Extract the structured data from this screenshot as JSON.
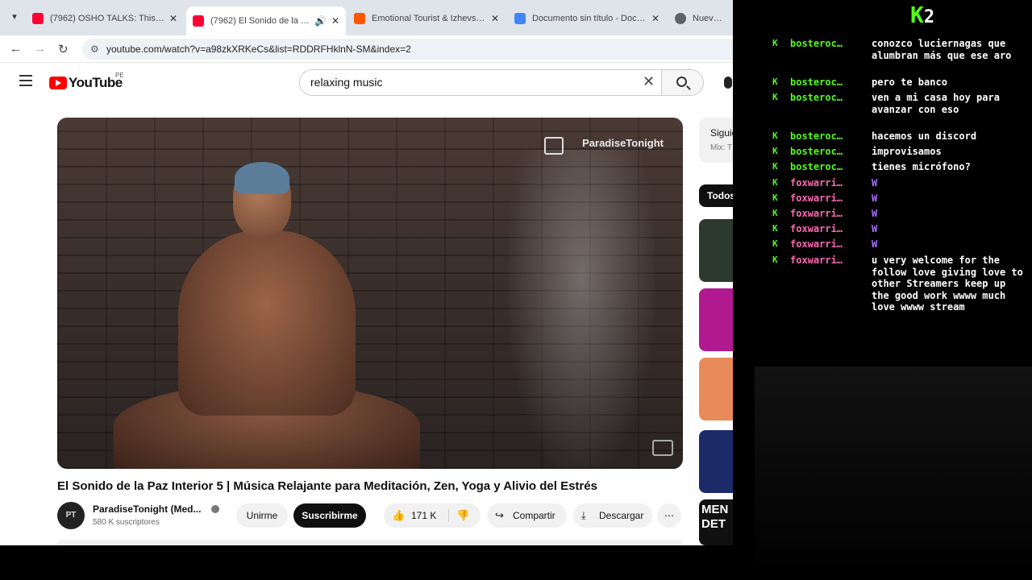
{
  "tabs": [
    {
      "title": "(7962) OSHO TALKS: This Is Onl",
      "favicon_color": "#ff0033",
      "active": false
    },
    {
      "title": "(7962) El Sonido de la Paz In",
      "favicon_color": "#ff0033",
      "active": true
    },
    {
      "title": "Emotional Tourist & Izhevski - L",
      "favicon_color": "#ff5500",
      "active": false
    },
    {
      "title": "Documento sin título - Docume",
      "favicon_color": "#4285f4",
      "active": false
    },
    {
      "title": "Nueva pest",
      "favicon_color": "#5f6368",
      "active": false
    }
  ],
  "address": {
    "url": "youtube.com/watch?v=a98zkXRKeCs&list=RDDRFHklnN-SM&index=2"
  },
  "youtube": {
    "logo_text": "YouTube",
    "country": "PE",
    "search_value": "relaxing music",
    "video": {
      "watermark": "ParadiseTonight",
      "title": "El Sonido de la Paz Interior 5 | Música Relajante para Meditación, Zen, Yoga y Alivio del Estrés",
      "channel": "ParadiseTonight (Med...",
      "avatar_text": "PT",
      "subscribers": "580 K suscriptores",
      "join_label": "Unirme",
      "subscribe_label": "Suscribirme",
      "likes": "171 K",
      "share_label": "Compartir",
      "download_label": "Descargar"
    },
    "sidebar": {
      "next_label": "Siguie",
      "next_sub": "Mix: T",
      "chip_all": "Todos",
      "thumb_colors": [
        "#2b3a2c",
        "#b0198f",
        "#e88a5a",
        "#1d2a6a",
        "#101010"
      ],
      "last_thumb_text": "MEN DET"
    }
  },
  "stream": {
    "logo": "K",
    "logo_num": "2",
    "chat": [
      {
        "user": "bosteroc…",
        "color": "green",
        "msg": "conozco luciernagas que alumbran más que ese aro"
      },
      {
        "user": "bosteroc…",
        "color": "green",
        "msg": "pero te banco"
      },
      {
        "user": "bosteroc…",
        "color": "green",
        "msg": "ven a mi casa hoy para avanzar con eso"
      },
      {
        "user": "bosteroc…",
        "color": "green",
        "msg": "hacemos un discord"
      },
      {
        "user": "bosteroc…",
        "color": "green",
        "msg": "improvisamos"
      },
      {
        "user": "bosteroc…",
        "color": "green",
        "msg": "tienes micrófono?"
      },
      {
        "user": "foxwarri…",
        "color": "pink",
        "msg": "W"
      },
      {
        "user": "foxwarri…",
        "color": "pink",
        "msg": "W"
      },
      {
        "user": "foxwarri…",
        "color": "pink",
        "msg": "W"
      },
      {
        "user": "foxwarri…",
        "color": "pink",
        "msg": "W"
      },
      {
        "user": "foxwarri…",
        "color": "pink",
        "msg": "W"
      },
      {
        "user": "foxwarri…",
        "color": "pink",
        "msg": "u very welcome for the follow love giving love to other Streamers keep up the good work wwww much love wwww stream"
      }
    ]
  }
}
